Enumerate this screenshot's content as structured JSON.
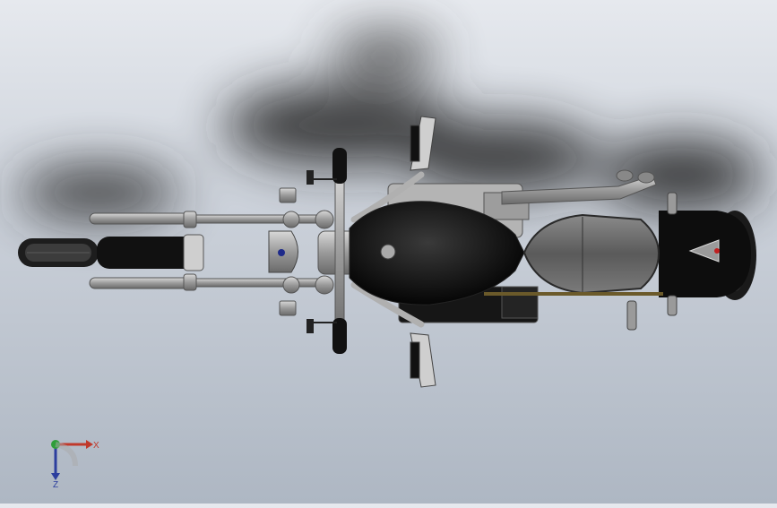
{
  "viewport": {
    "model": "motorcycle-top-view",
    "background_top": "#e6e9ee",
    "background_bottom": "#aeb7c3"
  },
  "triad": {
    "x_label": "X",
    "z_label": "Z",
    "x_color": "#c0392b",
    "y_color": "#2e9e3a",
    "z_color": "#2c3e9e"
  }
}
